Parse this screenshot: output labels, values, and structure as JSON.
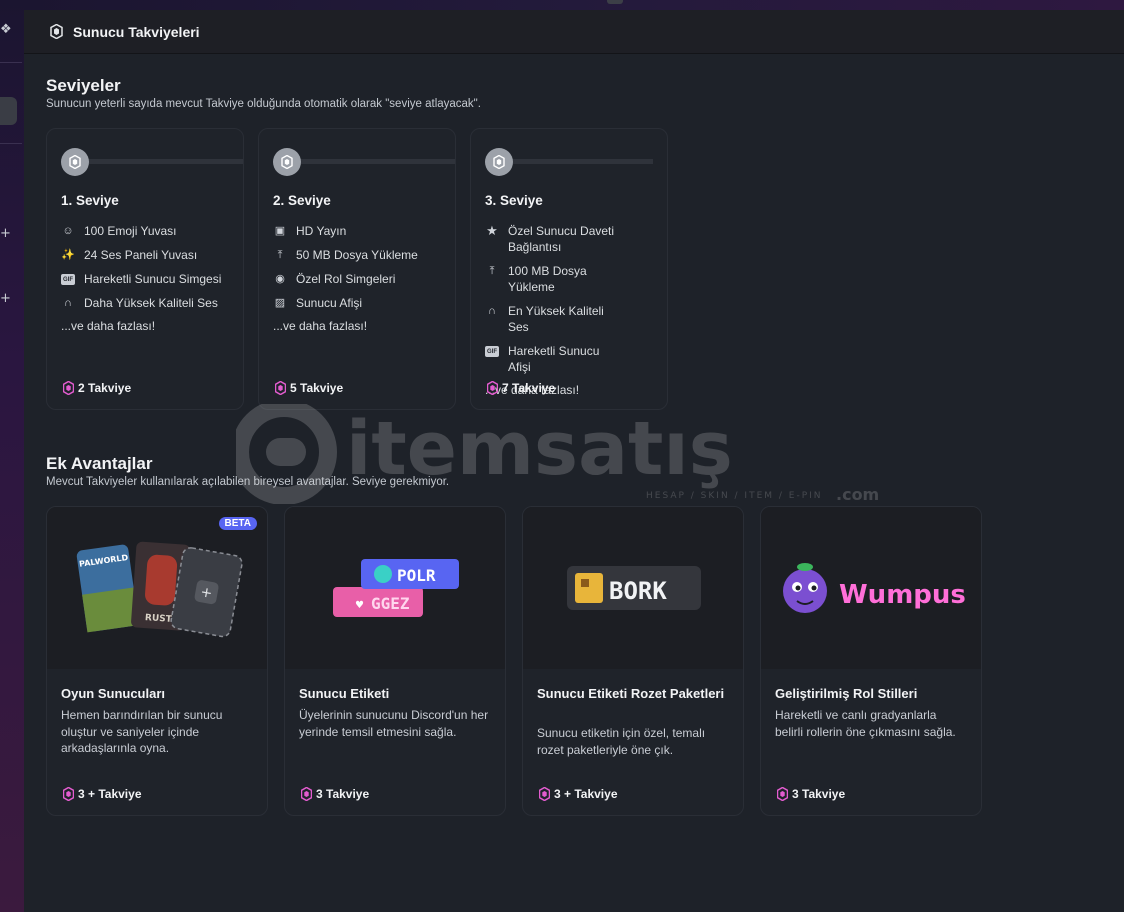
{
  "header": {
    "title": "Sunucu Takviyeleri"
  },
  "levels": {
    "title": "Seviyeler",
    "subtitle": "Sunucun yeterli sayıda mevcut Takviye olduğunda otomatik olarak \"seviye atlayacak\".",
    "tiers": [
      {
        "name": "1. Seviye",
        "perks": [
          {
            "icon": "emoji-icon",
            "label": "100 Emoji Yuvası"
          },
          {
            "icon": "soundboard-icon",
            "label": "24 Ses Paneli Yuvası"
          },
          {
            "icon": "gif-icon",
            "label": "Hareketli Sunucu Simgesi"
          },
          {
            "icon": "headphones-icon",
            "label": "Daha Yüksek Kaliteli Ses"
          }
        ],
        "more": "...ve daha fazlası!",
        "boosts": "2 Takviye"
      },
      {
        "name": "2. Seviye",
        "perks": [
          {
            "icon": "screen-share-icon",
            "label": "HD Yayın"
          },
          {
            "icon": "upload-icon",
            "label": "50 MB Dosya Yükleme"
          },
          {
            "icon": "role-icon",
            "label": "Özel Rol Simgeleri"
          },
          {
            "icon": "image-icon",
            "label": "Sunucu Afişi"
          }
        ],
        "more": "...ve daha fazlası!",
        "boosts": "5 Takviye"
      },
      {
        "name": "3. Seviye",
        "perks": [
          {
            "icon": "star-icon",
            "label": "Özel Sunucu Daveti Bağlantısı"
          },
          {
            "icon": "upload-icon",
            "label": "100 MB Dosya Yükleme"
          },
          {
            "icon": "headphones-icon",
            "label": "En Yüksek Kaliteli Ses"
          },
          {
            "icon": "gif-icon",
            "label": "Hareketli Sunucu Afişi"
          }
        ],
        "more": "...ve daha fazlası!",
        "boosts": "7 Takviye"
      }
    ]
  },
  "extras": {
    "title": "Ek Avantajlar",
    "subtitle": "Mevcut Takviyeler kullanılarak açılabilen bireysel avantajlar. Seviye gerekmiyor.",
    "cards": [
      {
        "title": "Oyun Sunucuları",
        "desc": "Hemen barındırılan bir sunucu oluştur ve saniyeler içinde arkadaşlarınla oyna.",
        "boosts": "3 + Takviye",
        "badge": "BETA",
        "banner_text_1": "PALWORLD",
        "banner_text_2": "RUST"
      },
      {
        "title": "Sunucu Etiketi",
        "desc": "Üyelerinin sunucunu Discord'un her yerinde temsil etmesini sağla.",
        "boosts": "3 Takviye",
        "tag_1": "POLR",
        "tag_2": "GGEZ"
      },
      {
        "title": "Sunucu Etiketi Rozet Paketleri",
        "desc": "Sunucu etiketin için özel, temalı rozet paketleriyle öne çık.",
        "boosts": "3 + Takviye",
        "tag": "BORK"
      },
      {
        "title": "Geliştirilmiş Rol Stilleri",
        "desc": "Hareketli ve canlı gradyanlarla belirli rollerin öne çıkmasını sağla.",
        "boosts": "3 Takviye",
        "name": "Wumpus"
      }
    ]
  },
  "watermark": {
    "brand": "itemsatış",
    "tagline": "HESAP / SKIN / ITEM / E-PIN",
    "suffix": ".com"
  },
  "colors": {
    "boost_pink": "#e35ccf",
    "beta_blue": "#5865f2",
    "wumpus_pink": "#ff6fd8"
  }
}
